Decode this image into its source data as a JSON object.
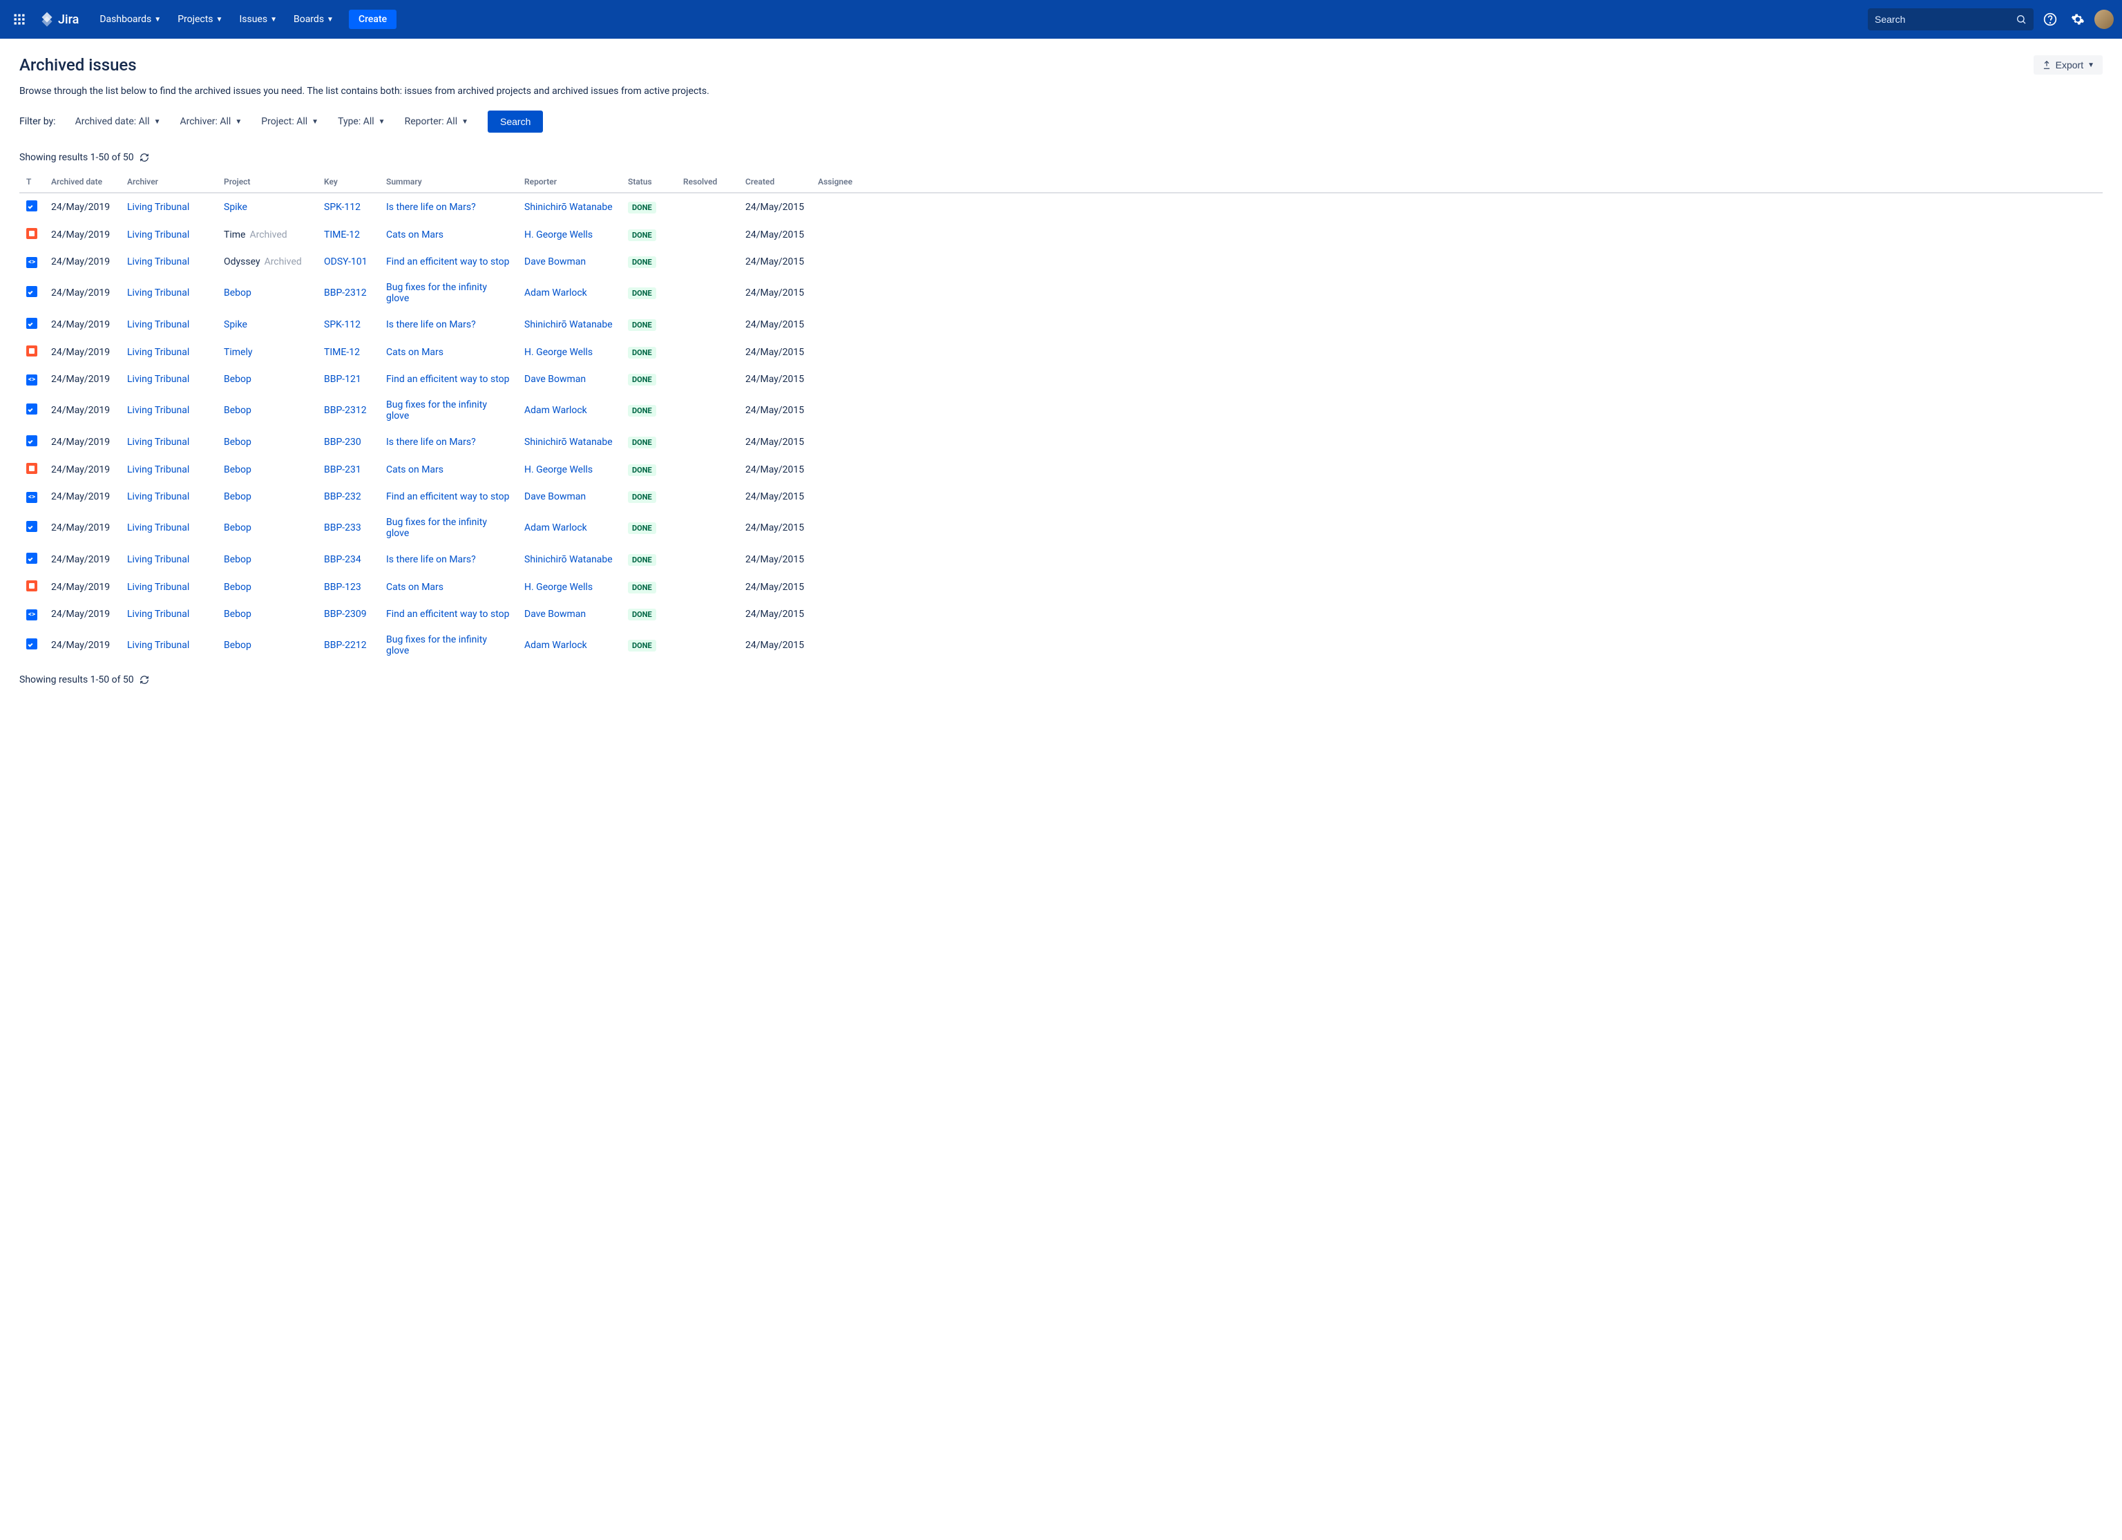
{
  "header": {
    "logo": "Jira",
    "nav": [
      "Dashboards",
      "Projects",
      "Issues",
      "Boards"
    ],
    "create": "Create",
    "search_placeholder": "Search"
  },
  "page": {
    "title": "Archived issues",
    "export": "Export",
    "description": "Browse through the list below to find the archived issues you need. The list contains both: issues from archived projects and archived issues from active projects."
  },
  "filters": {
    "label": "Filter by:",
    "items": [
      {
        "label": "Archived date:",
        "value": "All"
      },
      {
        "label": "Archiver:",
        "value": "All"
      },
      {
        "label": "Project:",
        "value": "All"
      },
      {
        "label": "Type:",
        "value": "All"
      },
      {
        "label": "Reporter:",
        "value": "All"
      }
    ],
    "search": "Search"
  },
  "results": {
    "text": "Showing results 1-50 of 50"
  },
  "columns": [
    "T",
    "Archived date",
    "Archiver",
    "Project",
    "Key",
    "Summary",
    "Reporter",
    "Status",
    "Resolved",
    "Created",
    "Assignee"
  ],
  "archived_label": "Archived",
  "rows": [
    {
      "type": "task",
      "date": "24/May/2019",
      "archiver": "Living Tribunal",
      "project": "Spike",
      "project_link": true,
      "key": "SPK-112",
      "summary": "Is there life on Mars?",
      "reporter": "Shinichirō Watanabe",
      "status": "DONE",
      "created": "24/May/2015"
    },
    {
      "type": "bug",
      "date": "24/May/2019",
      "archiver": "Living Tribunal",
      "project": "Time",
      "project_link": false,
      "archived": true,
      "key": "TIME-12",
      "summary": "Cats on Mars",
      "reporter": "H. George Wells",
      "status": "DONE",
      "created": "24/May/2015"
    },
    {
      "type": "code",
      "date": "24/May/2019",
      "archiver": "Living Tribunal",
      "project": "Odyssey",
      "project_link": false,
      "archived": true,
      "key": "ODSY-101",
      "summary": "Find an efficitent way to stop",
      "reporter": "Dave Bowman",
      "status": "DONE",
      "created": "24/May/2015"
    },
    {
      "type": "task",
      "date": "24/May/2019",
      "archiver": "Living Tribunal",
      "project": "Bebop",
      "project_link": true,
      "key": "BBP-2312",
      "summary": "Bug fixes for the infinity glove",
      "reporter": "Adam Warlock",
      "status": "DONE",
      "created": "24/May/2015"
    },
    {
      "type": "task",
      "date": "24/May/2019",
      "archiver": "Living Tribunal",
      "project": "Spike",
      "project_link": true,
      "key": "SPK-112",
      "summary": "Is there life on Mars?",
      "reporter": "Shinichirō Watanabe",
      "status": "DONE",
      "created": "24/May/2015"
    },
    {
      "type": "bug",
      "date": "24/May/2019",
      "archiver": "Living Tribunal",
      "project": "Timely",
      "project_link": true,
      "key": "TIME-12",
      "summary": "Cats on Mars",
      "reporter": "H. George Wells",
      "status": "DONE",
      "created": "24/May/2015"
    },
    {
      "type": "code",
      "date": "24/May/2019",
      "archiver": "Living Tribunal",
      "project": "Bebop",
      "project_link": true,
      "key": "BBP-121",
      "summary": "Find an efficitent way to stop",
      "reporter": "Dave Bowman",
      "status": "DONE",
      "created": "24/May/2015"
    },
    {
      "type": "task",
      "date": "24/May/2019",
      "archiver": "Living Tribunal",
      "project": "Bebop",
      "project_link": true,
      "key": "BBP-2312",
      "summary": "Bug fixes for the infinity glove",
      "reporter": "Adam Warlock",
      "status": "DONE",
      "created": "24/May/2015"
    },
    {
      "type": "task",
      "date": "24/May/2019",
      "archiver": "Living Tribunal",
      "project": "Bebop",
      "project_link": true,
      "key": "BBP-230",
      "summary": "Is there life on Mars?",
      "reporter": "Shinichirō Watanabe",
      "status": "DONE",
      "created": "24/May/2015"
    },
    {
      "type": "bug",
      "date": "24/May/2019",
      "archiver": "Living Tribunal",
      "project": "Bebop",
      "project_link": true,
      "key": "BBP-231",
      "summary": "Cats on Mars",
      "reporter": "H. George Wells",
      "status": "DONE",
      "created": "24/May/2015"
    },
    {
      "type": "code",
      "date": "24/May/2019",
      "archiver": "Living Tribunal",
      "project": "Bebop",
      "project_link": true,
      "key": "BBP-232",
      "summary": "Find an efficitent way to stop",
      "reporter": "Dave Bowman",
      "status": "DONE",
      "created": "24/May/2015"
    },
    {
      "type": "task",
      "date": "24/May/2019",
      "archiver": "Living Tribunal",
      "project": "Bebop",
      "project_link": true,
      "key": "BBP-233",
      "summary": "Bug fixes for the infinity glove",
      "reporter": "Adam Warlock",
      "status": "DONE",
      "created": "24/May/2015"
    },
    {
      "type": "task",
      "date": "24/May/2019",
      "archiver": "Living Tribunal",
      "project": "Bebop",
      "project_link": true,
      "key": "BBP-234",
      "summary": "Is there life on Mars?",
      "reporter": "Shinichirō Watanabe",
      "status": "DONE",
      "created": "24/May/2015"
    },
    {
      "type": "bug",
      "date": "24/May/2019",
      "archiver": "Living Tribunal",
      "project": "Bebop",
      "project_link": true,
      "key": "BBP-123",
      "summary": "Cats on Mars",
      "reporter": "H. George Wells",
      "status": "DONE",
      "created": "24/May/2015"
    },
    {
      "type": "code",
      "date": "24/May/2019",
      "archiver": "Living Tribunal",
      "project": "Bebop",
      "project_link": true,
      "key": "BBP-2309",
      "summary": "Find an efficitent way to stop",
      "reporter": "Dave Bowman",
      "status": "DONE",
      "created": "24/May/2015"
    },
    {
      "type": "task",
      "date": "24/May/2019",
      "archiver": "Living Tribunal",
      "project": "Bebop",
      "project_link": true,
      "key": "BBP-2212",
      "summary": "Bug fixes for the infinity glove",
      "reporter": "Adam Warlock",
      "status": "DONE",
      "created": "24/May/2015"
    }
  ]
}
